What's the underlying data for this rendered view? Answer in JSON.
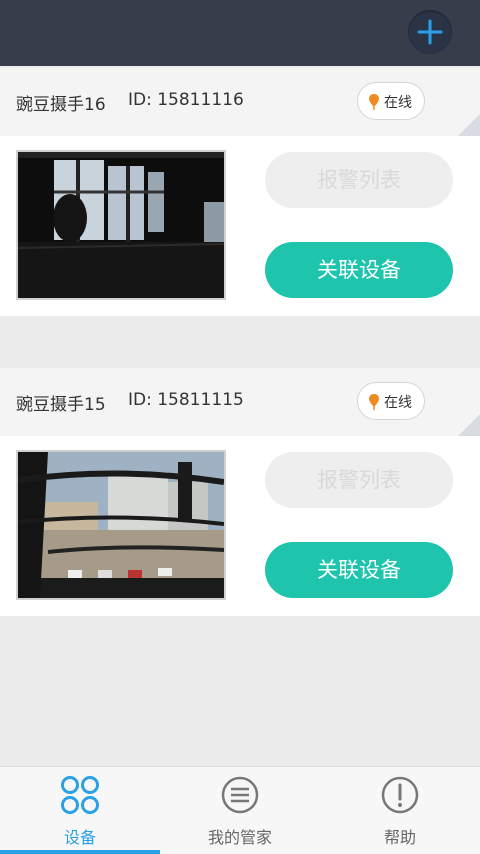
{
  "header": {
    "add_icon": "plus-icon",
    "background": "#383d4c",
    "accent": "#2aa0e6"
  },
  "devices": [
    {
      "name": "豌豆摄手16",
      "id_text": "ID: 15811116",
      "status": "在线",
      "alarm_label": "报警列表",
      "link_label": "关联设备",
      "snapshot": "indoor-window-view"
    },
    {
      "name": "豌豆摄手15",
      "id_text": "ID: 15811115",
      "status": "在线",
      "alarm_label": "报警列表",
      "link_label": "关联设备",
      "snapshot": "outdoor-parking-view"
    }
  ],
  "nav": {
    "items": [
      {
        "label": "设备",
        "icon": "device-grid-icon",
        "active": true
      },
      {
        "label": "我的管家",
        "icon": "menu-lines-icon",
        "active": false
      },
      {
        "label": "帮助",
        "icon": "exclamation-icon",
        "active": false
      }
    ]
  },
  "colors": {
    "primary_button": "#1fc4ad",
    "disabled_button": "#eeeeee",
    "status_pin": "#f08a24"
  }
}
